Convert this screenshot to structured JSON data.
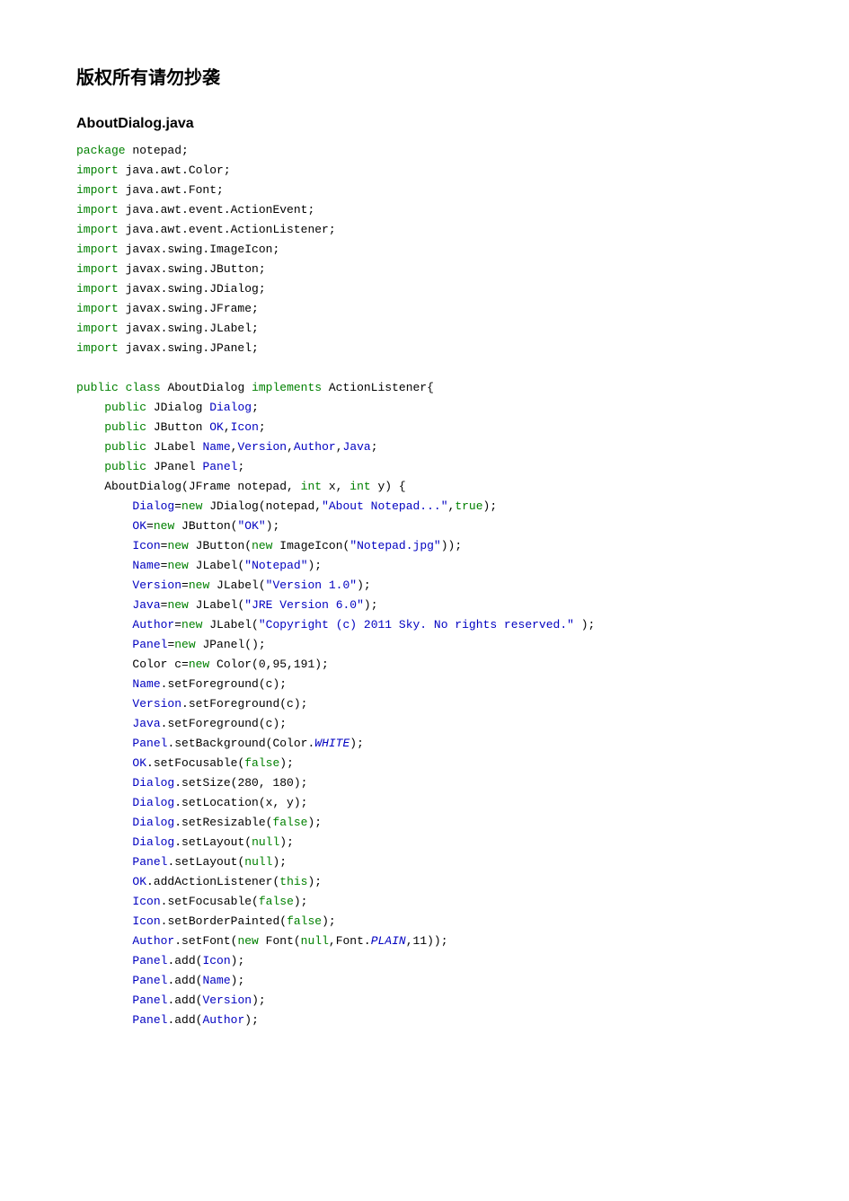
{
  "title": "版权所有请勿抄袭",
  "subtitle": "AboutDialog.java",
  "code_html": "<span class=\"kw\">package</span> notepad;\n<span class=\"kw\">import</span> java.awt.Color;\n<span class=\"kw\">import</span> java.awt.Font;\n<span class=\"kw\">import</span> java.awt.event.ActionEvent;\n<span class=\"kw\">import</span> java.awt.event.ActionListener;\n<span class=\"kw\">import</span> javax.swing.ImageIcon;\n<span class=\"kw\">import</span> javax.swing.JButton;\n<span class=\"kw\">import</span> javax.swing.JDialog;\n<span class=\"kw\">import</span> javax.swing.JFrame;\n<span class=\"kw\">import</span> javax.swing.JLabel;\n<span class=\"kw\">import</span> javax.swing.JPanel;\n\n<span class=\"kw\">public</span> <span class=\"kw\">class</span> AboutDialog <span class=\"kw\">implements</span> ActionListener{\n    <span class=\"kw\">public</span> JDialog <span class=\"mem\">Dialog</span>;\n    <span class=\"kw\">public</span> JButton <span class=\"mem\">OK</span>,<span class=\"mem\">Icon</span>;\n    <span class=\"kw\">public</span> JLabel <span class=\"mem\">Name</span>,<span class=\"mem\">Version</span>,<span class=\"mem\">Author</span>,<span class=\"mem\">Java</span>;\n    <span class=\"kw\">public</span> JPanel <span class=\"mem\">Panel</span>;\n    AboutDialog(JFrame notepad, <span class=\"kw\">int</span> x, <span class=\"kw\">int</span> y) {\n        <span class=\"mem\">Dialog</span>=<span class=\"kw\">new</span> JDialog(notepad,<span class=\"str\">\"About Notepad...\"</span>,<span class=\"kw\">true</span>);\n        <span class=\"mem\">OK</span>=<span class=\"kw\">new</span> JButton(<span class=\"str\">\"OK\"</span>);\n        <span class=\"mem\">Icon</span>=<span class=\"kw\">new</span> JButton(<span class=\"kw\">new</span> ImageIcon(<span class=\"str\">\"Notepad.jpg\"</span>));\n        <span class=\"mem\">Name</span>=<span class=\"kw\">new</span> JLabel(<span class=\"str\">\"Notepad\"</span>);\n        <span class=\"mem\">Version</span>=<span class=\"kw\">new</span> JLabel(<span class=\"str\">\"Version 1.0\"</span>);\n        <span class=\"mem\">Java</span>=<span class=\"kw\">new</span> JLabel(<span class=\"str\">\"JRE Version 6.0\"</span>);\n        <span class=\"mem\">Author</span>=<span class=\"kw\">new</span> JLabel(<span class=\"str\">\"Copyright (c) 2011 Sky. No rights reserved.\"</span> );\n        <span class=\"mem\">Panel</span>=<span class=\"kw\">new</span> JPanel();\n        Color c=<span class=\"kw\">new</span> Color(0,95,191);\n        <span class=\"mem\">Name</span>.setForeground(c);\n        <span class=\"mem\">Version</span>.setForeground(c);\n        <span class=\"mem\">Java</span>.setForeground(c);\n        <span class=\"mem\">Panel</span>.setBackground(Color.<span class=\"con\">WHITE</span>);\n        <span class=\"mem\">OK</span>.setFocusable(<span class=\"kw\">false</span>);\n        <span class=\"mem\">Dialog</span>.setSize(280, 180);\n        <span class=\"mem\">Dialog</span>.setLocation(x, y);\n        <span class=\"mem\">Dialog</span>.setResizable(<span class=\"kw\">false</span>);\n        <span class=\"mem\">Dialog</span>.setLayout(<span class=\"kw\">null</span>);\n        <span class=\"mem\">Panel</span>.setLayout(<span class=\"kw\">null</span>);\n        <span class=\"mem\">OK</span>.addActionListener(<span class=\"kw\">this</span>);\n        <span class=\"mem\">Icon</span>.setFocusable(<span class=\"kw\">false</span>);\n        <span class=\"mem\">Icon</span>.setBorderPainted(<span class=\"kw\">false</span>);\n        <span class=\"mem\">Author</span>.setFont(<span class=\"kw\">new</span> Font(<span class=\"kw\">null</span>,Font.<span class=\"con\">PLAIN</span>,11));\n        <span class=\"mem\">Panel</span>.add(<span class=\"mem\">Icon</span>);\n        <span class=\"mem\">Panel</span>.add(<span class=\"mem\">Name</span>);\n        <span class=\"mem\">Panel</span>.add(<span class=\"mem\">Version</span>);\n        <span class=\"mem\">Panel</span>.add(<span class=\"mem\">Author</span>);"
}
